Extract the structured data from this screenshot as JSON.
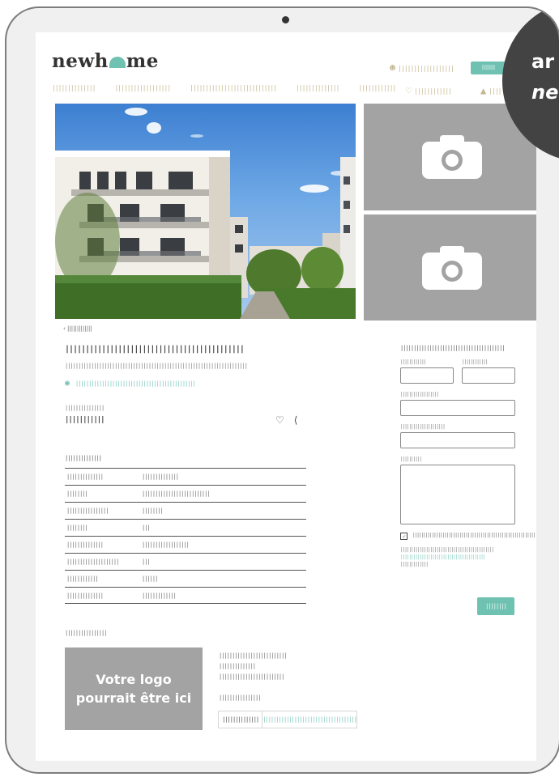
{
  "frame": {
    "device": "tablet"
  },
  "badge": {
    "line1": "ar",
    "line2": "nev"
  },
  "header": {
    "logo": {
      "prefix": "newh",
      "suffix": "me"
    },
    "nav": [
      "||||||||||||||",
      "||||||||||||||||||",
      "||||||||||||||||||||||||||||",
      "||||||||||||||",
      "||||||||||||"
    ],
    "account_label": "||||||||||||||||||",
    "primary_button": "||||||||",
    "favorites_label": "||||||||||||",
    "alerts_label": "||||"
  },
  "listing": {
    "back_link": "‹ |||||||||||||",
    "title": "||||||||||||||||||||||||||||||||||||||||||||",
    "subtitle": "||||||||||||||||||||||||||||||||||||||||||||||||||||||||||||||||||||||",
    "location": "||||||||||||||||||||||||||||||||||||||||||||||",
    "price_label": "|||||||||||||||",
    "price_value": "|||||||||||",
    "section_title": "||||||||||||||"
  },
  "specs": [
    {
      "key": "||||||||||||||",
      "value": "||||||||||||||"
    },
    {
      "key": "||||||||",
      "value": "||||||||||||||||||||||||||"
    },
    {
      "key": "||||||||||||||||",
      "value": "||||||||"
    },
    {
      "key": "||||||||",
      "value": "|||"
    },
    {
      "key": "||||||||||||||",
      "value": "||||||||||||||||||"
    },
    {
      "key": "||||||||||||||||||||",
      "value": "|||"
    },
    {
      "key": "||||||||||||",
      "value": "||||||"
    },
    {
      "key": "||||||||||||||",
      "value": "|||||||||||||"
    }
  ],
  "agent": {
    "section_title": "||||||||||||||||",
    "logo_placeholder_line1": "Votre logo",
    "logo_placeholder_line2": "pourrait être ici",
    "info_lines": [
      "||||||||||||||||||||||||||",
      "||||||||||||||",
      "|||||||||||||||||||||||||"
    ],
    "phone_label": "||||||||||||||||",
    "phone_button": "||||||||||||||",
    "phone_value": "||||||||||||||||||||||||||||||||||||"
  },
  "contact_form": {
    "title": "||||||||||||||||||||||||||||||||||||||||",
    "first_name_label": "||||||||||||",
    "last_name_label": "||||||||||||",
    "email_label": "||||||||||||||||||",
    "phone_label": "|||||||||||||||||||||",
    "message_label": "||||||||||",
    "consent_text": "||||||||||||||||||||||||||||||||||||||||||||||||||||||||||||||||||||||||||||||||||||",
    "legal_line1": "||||||||||||||||||||||||||||||||||||||||||||",
    "legal_link": "||||||||||||||||||||||||||||||||||||||||",
    "legal_line2": "|||||||||||||",
    "send_label": "||||||||",
    "consent_checked": true
  },
  "colors": {
    "accent": "#6fc2b2",
    "nav_text": "#c4b78f",
    "placeholder_gray": "#a3a3a3",
    "badge": "#434343"
  },
  "icons": [
    "camera-icon",
    "user-icon",
    "heart-icon",
    "bell-icon",
    "location-pin-icon",
    "share-icon",
    "check-icon"
  ]
}
